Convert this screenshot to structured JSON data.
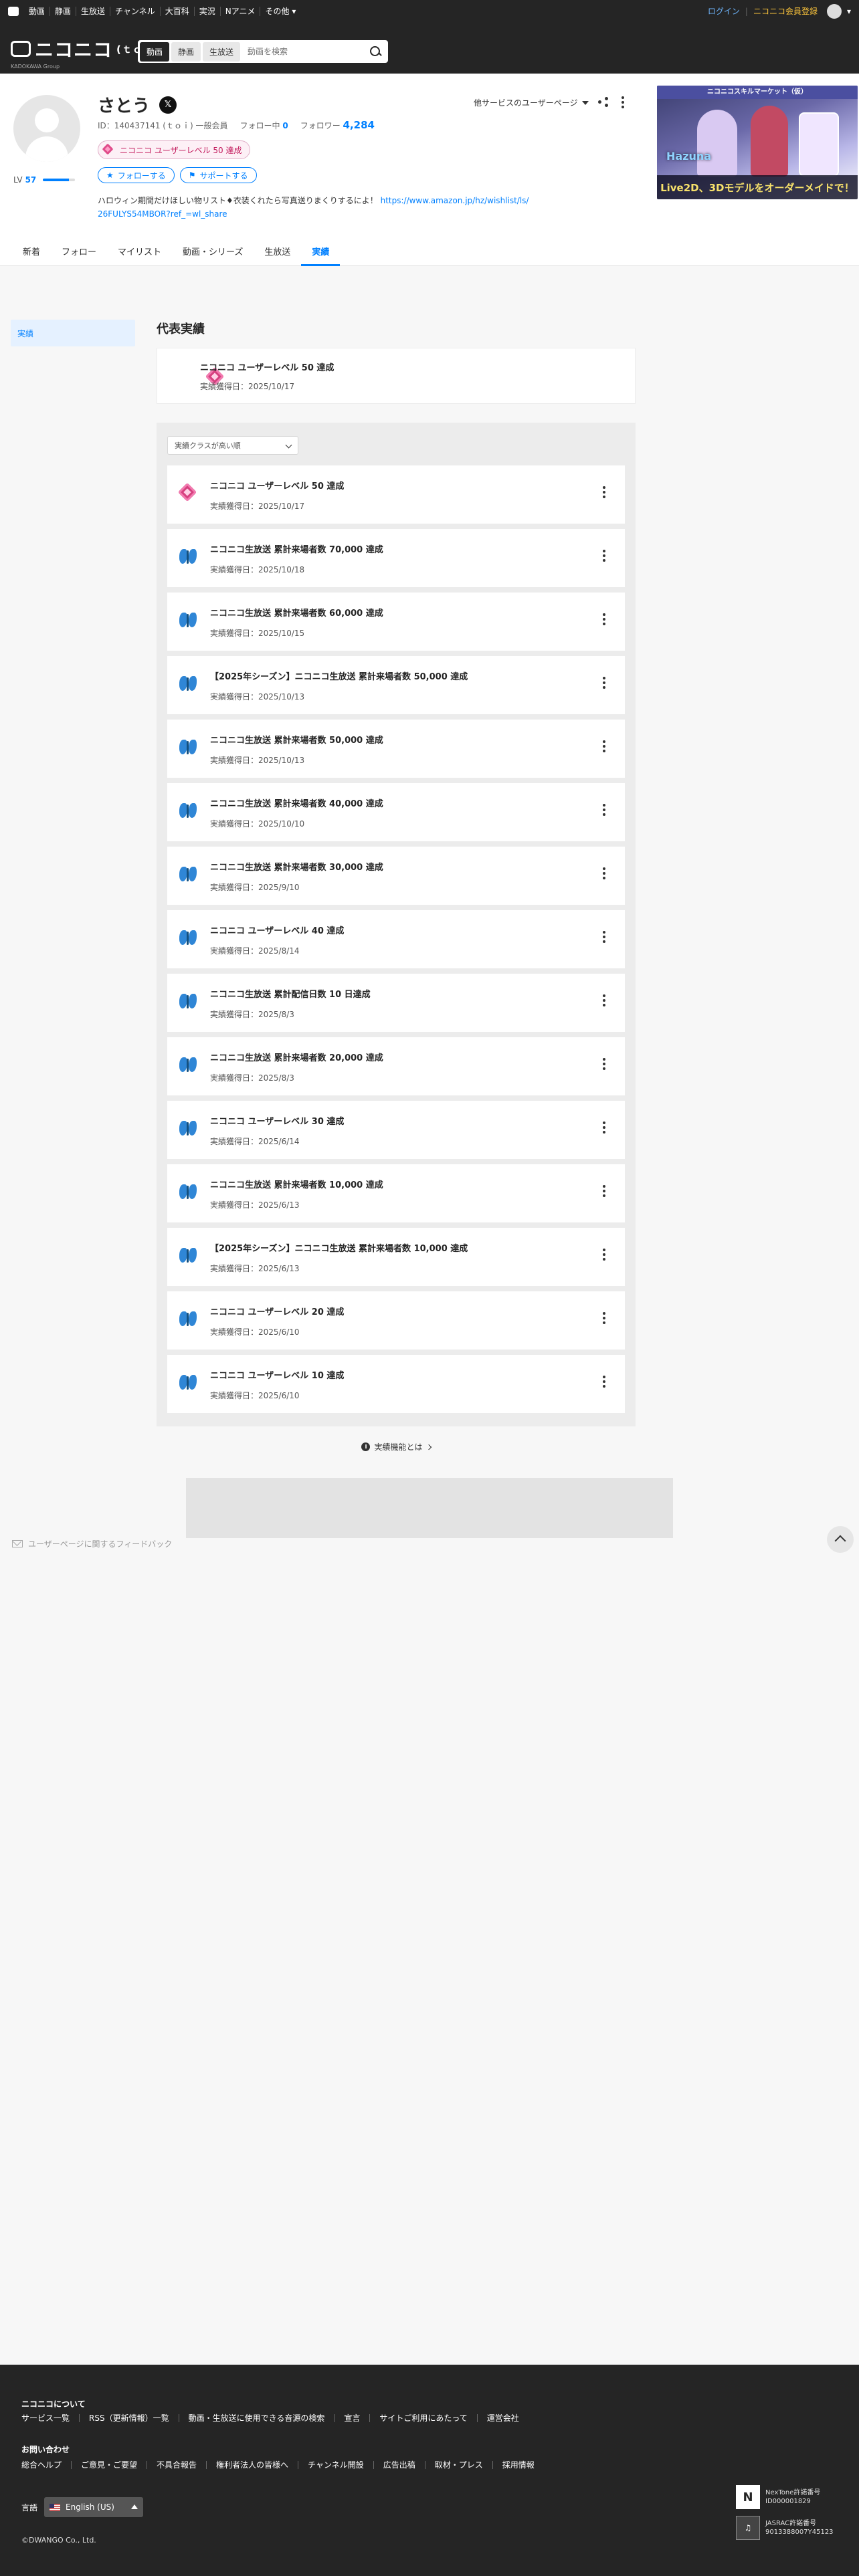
{
  "topbar": {
    "nav": [
      "動画",
      "静画",
      "生放送",
      "チャンネル",
      "大百科",
      "実況",
      "Nアニメ",
      "その他"
    ],
    "login": "ログイン",
    "register": "ニコニコ会員登録"
  },
  "header": {
    "brand": "ニコニコ",
    "brand_suffix": "(ｔｏｉ)",
    "brand_sub": "KADOKAWA Group",
    "search_tabs": [
      "動画",
      "静画",
      "生放送"
    ],
    "search_placeholder": "動画を検索"
  },
  "profile": {
    "name": "さとう",
    "x_icon_label": "𝕏",
    "id_text": "ID：140437141 (ｔｏｉ) 一般会員",
    "following_label": "フォロー中",
    "following_count": "0",
    "followers_label": "フォロワー",
    "followers_count": "4,284",
    "level_label": "LV",
    "level_value": "57",
    "level_progress": 0.8,
    "badge": "ニコニコ ユーザーレベル 50 達成",
    "follow_btn": "フォローする",
    "support_btn": "サポートする",
    "description": "ハロウィン期間だけほしい物リスト♦衣装くれたら写真送りまくりするによ！",
    "description_link": "https://www.amazon.jp/hz/wishlist/ls/26FULYS54MBOR?ref_=wl_share",
    "other_services": "他サービスのユーザーページ"
  },
  "ad": {
    "top": "ニコニコスキルマーケット（仮）",
    "brand": "Hazuna",
    "bottom": "Live2D、3Dモデルをオーダーメイドで！"
  },
  "tabs": [
    "新着",
    "フォロー",
    "マイリスト",
    "動画・シリーズ",
    "生放送",
    "実績"
  ],
  "sidebar": {
    "active": "実績",
    "feedback": "ユーザーページに関するフィードバック"
  },
  "main": {
    "rep_title": "代表実績",
    "rep": {
      "title": "ニコニコ ユーザーレベル 50 達成",
      "date": "実績獲得日：2025/10/17",
      "icon": "gem-icon"
    },
    "sort_label": "実績クラスが高い順",
    "items": [
      {
        "title": "ニコニコ ユーザーレベル 50 達成",
        "date": "実績獲得日：2025/10/17",
        "icon": "gem-icon"
      },
      {
        "title": "ニコニコ生放送 累計来場者数 70,000 達成",
        "date": "実績獲得日：2025/10/18",
        "icon": "butterfly-icon"
      },
      {
        "title": "ニコニコ生放送 累計来場者数 60,000 達成",
        "date": "実績獲得日：2025/10/15",
        "icon": "butterfly-icon"
      },
      {
        "title": "【2025年シーズン】ニコニコ生放送 累計来場者数 50,000 達成",
        "date": "実績獲得日：2025/10/13",
        "icon": "butterfly-icon"
      },
      {
        "title": "ニコニコ生放送 累計来場者数 50,000 達成",
        "date": "実績獲得日：2025/10/13",
        "icon": "butterfly-icon"
      },
      {
        "title": "ニコニコ生放送 累計来場者数 40,000 達成",
        "date": "実績獲得日：2025/10/10",
        "icon": "butterfly-icon"
      },
      {
        "title": "ニコニコ生放送 累計来場者数 30,000 達成",
        "date": "実績獲得日：2025/9/10",
        "icon": "butterfly-icon"
      },
      {
        "title": "ニコニコ ユーザーレベル 40 達成",
        "date": "実績獲得日：2025/8/14",
        "icon": "butterfly-icon"
      },
      {
        "title": "ニコニコ生放送 累計配信日数 10 日達成",
        "date": "実績獲得日：2025/8/3",
        "icon": "butterfly-icon"
      },
      {
        "title": "ニコニコ生放送 累計来場者数 20,000 達成",
        "date": "実績獲得日：2025/8/3",
        "icon": "butterfly-icon"
      },
      {
        "title": "ニコニコ ユーザーレベル 30 達成",
        "date": "実績獲得日：2025/6/14",
        "icon": "butterfly-icon"
      },
      {
        "title": "ニコニコ生放送 累計来場者数 10,000 達成",
        "date": "実績獲得日：2025/6/13",
        "icon": "butterfly-icon"
      },
      {
        "title": "【2025年シーズン】ニコニコ生放送 累計来場者数 10,000 達成",
        "date": "実績獲得日：2025/6/13",
        "icon": "butterfly-icon"
      },
      {
        "title": "ニコニコ ユーザーレベル 20 達成",
        "date": "実績獲得日：2025/6/10",
        "icon": "butterfly-icon"
      },
      {
        "title": "ニコニコ ユーザーレベル 10 達成",
        "date": "実績獲得日：2025/6/10",
        "icon": "butterfly-icon"
      }
    ],
    "about": "実績機能とは"
  },
  "footer": {
    "about_head": "ニコニコについて",
    "about_links": [
      "サービス一覧",
      "RSS（更新情報）一覧",
      "動画・生放送に使用できる音源の検索",
      "宣言",
      "サイトご利用にあたって",
      "運営会社"
    ],
    "contact_head": "お問い合わせ",
    "contact_links": [
      "総合ヘルプ",
      "ご意見・ご要望",
      "不具合報告",
      "権利者法人の皆様へ",
      "チャンネル開設",
      "広告出稿",
      "取材・プレス",
      "採用情報"
    ],
    "lang_label": "言語",
    "lang_value": "English (US)",
    "copyright": "©DWANGO Co., Ltd.",
    "license1": [
      "NexTone許諾番号",
      "ID000001829"
    ],
    "license2": [
      "JASRAC許諾番号",
      "9013388007Y45123"
    ]
  },
  "colors": {
    "accent": "#0080ff",
    "dark": "#252525",
    "badge": "#c2185b"
  }
}
